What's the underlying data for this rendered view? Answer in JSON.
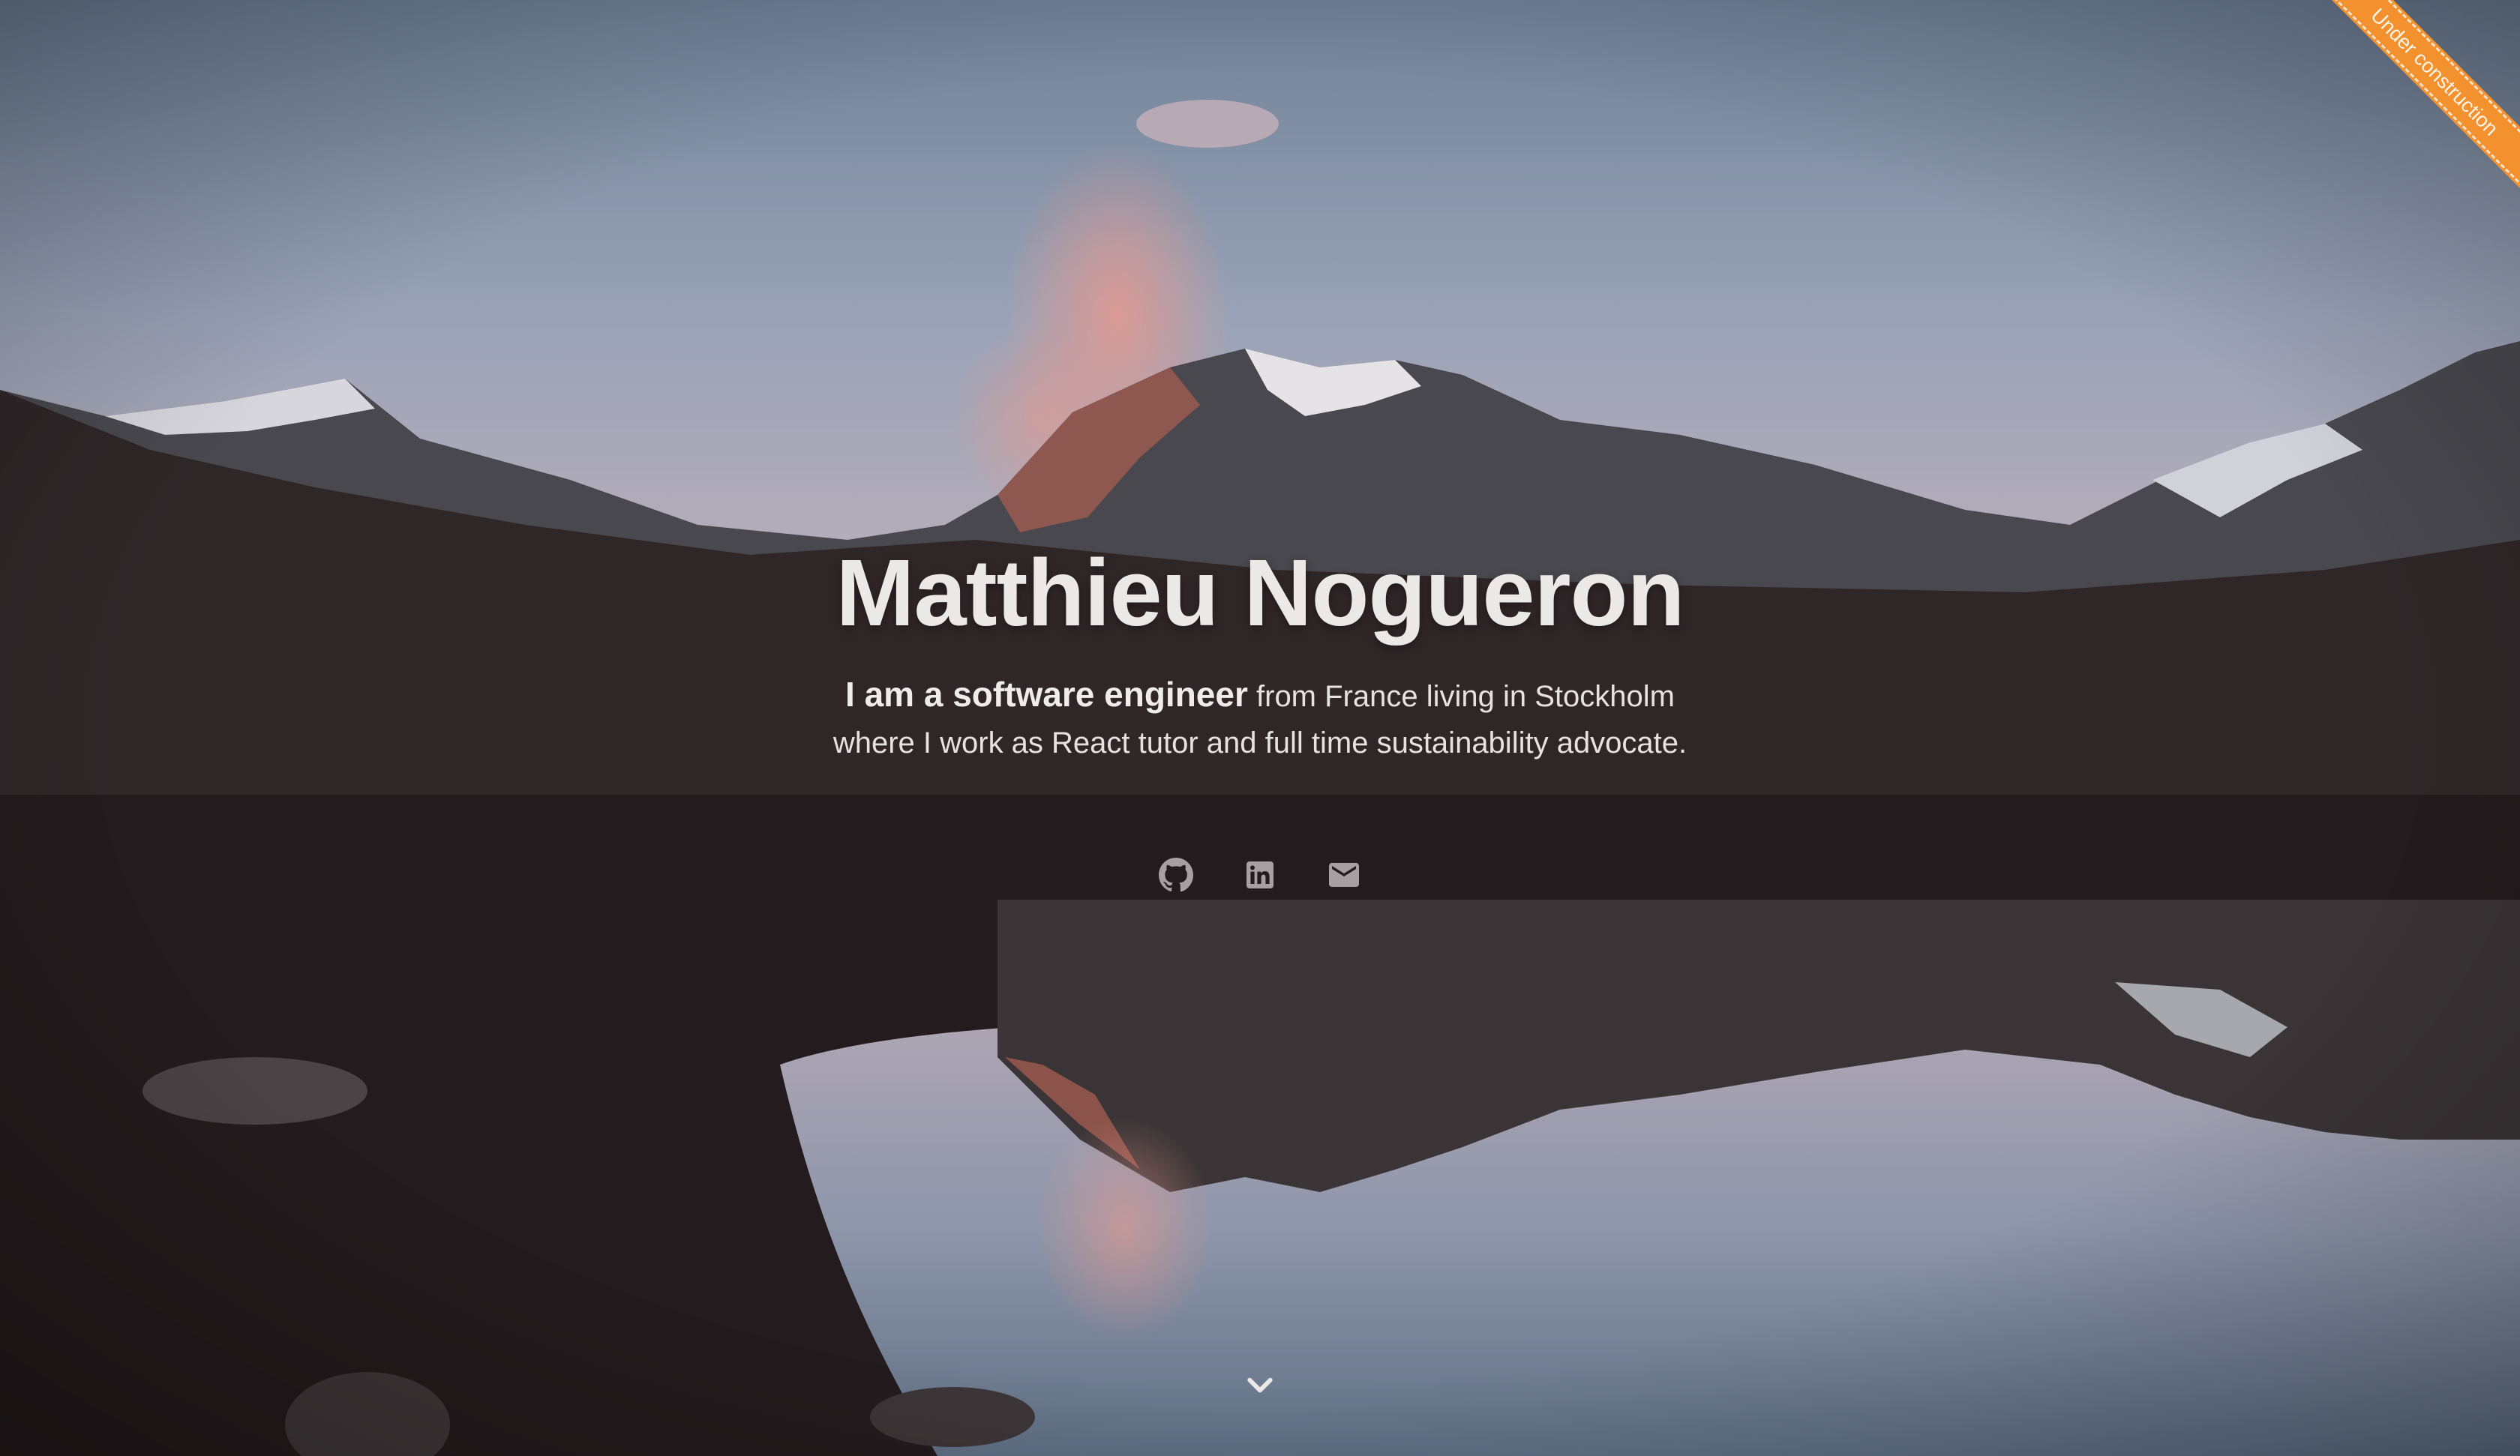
{
  "banner": {
    "text": "Under construction",
    "color": "#f3912f"
  },
  "hero": {
    "name": "Matthieu Nogueron",
    "bio_strong": "I am a software engineer",
    "bio_rest": " from France living in Stockholm where I work as React tutor and full time sustainability advocate."
  },
  "social": [
    {
      "icon": "github-icon",
      "label": "GitHub"
    },
    {
      "icon": "linkedin-icon",
      "label": "LinkedIn"
    },
    {
      "icon": "email-icon",
      "label": "Email"
    }
  ],
  "scroll": {
    "icon": "chevron-down-icon"
  }
}
